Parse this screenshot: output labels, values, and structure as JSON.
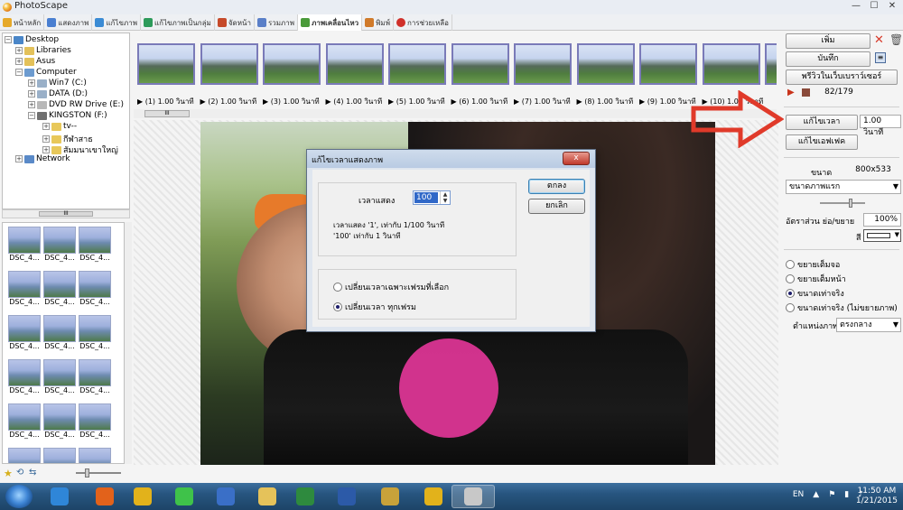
{
  "app": {
    "title": "PhotoScape"
  },
  "tabs": [
    {
      "label": "หน้าหลัก",
      "icon": "home-icon",
      "color": "#e6a92a"
    },
    {
      "label": "แสดงภาพ",
      "icon": "viewer-icon",
      "color": "#4a7fd1"
    },
    {
      "label": "แก้ไขภาพ",
      "icon": "editor-icon",
      "color": "#3b8bd4"
    },
    {
      "label": "แก้ไขภาพเป็นกลุ่ม",
      "icon": "batch-icon",
      "color": "#2d9a5a"
    },
    {
      "label": "จัดหน้า",
      "icon": "page-icon",
      "color": "#c64a2a"
    },
    {
      "label": "รวมภาพ",
      "icon": "combine-icon",
      "color": "#5a7fc8"
    },
    {
      "label": "ภาพเคลื่อนไหว",
      "icon": "gif-icon",
      "color": "#4a9a3a"
    },
    {
      "label": "พิมพ์",
      "icon": "print-icon",
      "color": "#d07a2a"
    },
    {
      "label": "การช่วยเหลือ",
      "icon": "help-icon",
      "color": "#d0302a"
    }
  ],
  "tree": {
    "desktop": "Desktop",
    "libraries": "Libraries",
    "asus": "Asus",
    "computer": "Computer",
    "c": "Win7 (C:)",
    "d": "DATA (D:)",
    "e": "DVD RW Drive (E:)",
    "f": "KINGSTON (F:)",
    "f1": "tv--",
    "f2": "กีฬาสาธ",
    "f3": "สัมมนาเขาใหญ่",
    "network": "Network"
  },
  "thumbs_caption": "DSC_4...",
  "frames": [
    "▶ (1) 1.00 วินาที",
    "▶ (2) 1.00 วินาที",
    "▶ (3) 1.00 วินาที",
    "▶ (4) 1.00 วินาที",
    "▶ (5) 1.00 วินาที",
    "▶ (6) 1.00 วินาที",
    "▶ (7) 1.00 วินาที",
    "▶ (8) 1.00 วินาที",
    "▶ (9) 1.00 วินาที",
    "▶ (10) 1.00 วินาที"
  ],
  "right": {
    "add": "เพิ่ม",
    "save": "บันทึก",
    "preview": "พรีวิวในเว็บเบราว์เซอร์",
    "counter": "82/179",
    "edit_time": "แก้ไขเวลา",
    "time_value": "1.00 วินาที",
    "edit_effect": "แก้ไขเอฟเฟค",
    "size_label": "ขนาด",
    "size_value": "800x533",
    "size_select": "ขนาดภาพแรก",
    "ratio_label": "อัตราส่วน ย่อ/ขยาย",
    "ratio_value": "100%",
    "color_label": "สี",
    "radio1": "ขยายเต็มจอ",
    "radio2": "ขยายเต็มหน้า",
    "radio3": "ขนาดเท่าจริง",
    "radio4": "ขนาดเท่าจริง (ไม่ขยายภาพ)",
    "position_label": "ตำแหน่งภาพ",
    "position_value": "ตรงกลาง"
  },
  "dialog": {
    "title": "แก้ไขเวลาแสดงภาพ",
    "close": "x",
    "field_label": "เวลาแสดง",
    "field_value": "100",
    "note1": "เวลาแสดง  '1', เท่ากับ 1/100 วินาที",
    "note2": "'100' เท่ากับ 1 วินาที",
    "ok": "ตกลง",
    "cancel": "ยกเลิก",
    "opt1": "เปลี่ยนเวลาเฉพาะเฟรมที่เลือก",
    "opt2": "เปลี่ยนเวลา ทุกเฟรม"
  },
  "taskbar": {
    "lang": "EN",
    "time": "11:50 AM",
    "date": "1/21/2015",
    "apps": [
      {
        "name": "ie-icon",
        "color": "#2f86d8"
      },
      {
        "name": "firefox-icon",
        "color": "#e2621b"
      },
      {
        "name": "chrome-icon",
        "color": "#e2b21b"
      },
      {
        "name": "line-icon",
        "color": "#3fc24a"
      },
      {
        "name": "google-earth-icon",
        "color": "#3a6fc7"
      },
      {
        "name": "folder-icon",
        "color": "#e5c25a"
      },
      {
        "name": "excel-icon",
        "color": "#2e8a3e"
      },
      {
        "name": "word-icon",
        "color": "#2c5aa8"
      },
      {
        "name": "disc-icon",
        "color": "#c8a23a"
      },
      {
        "name": "chrome-icon-2",
        "color": "#e2b21b"
      },
      {
        "name": "photoscape-icon",
        "color": "#c8c8c8"
      }
    ]
  },
  "colors": {
    "accent_red": "#e03a2a",
    "selection": "#3068c8"
  }
}
